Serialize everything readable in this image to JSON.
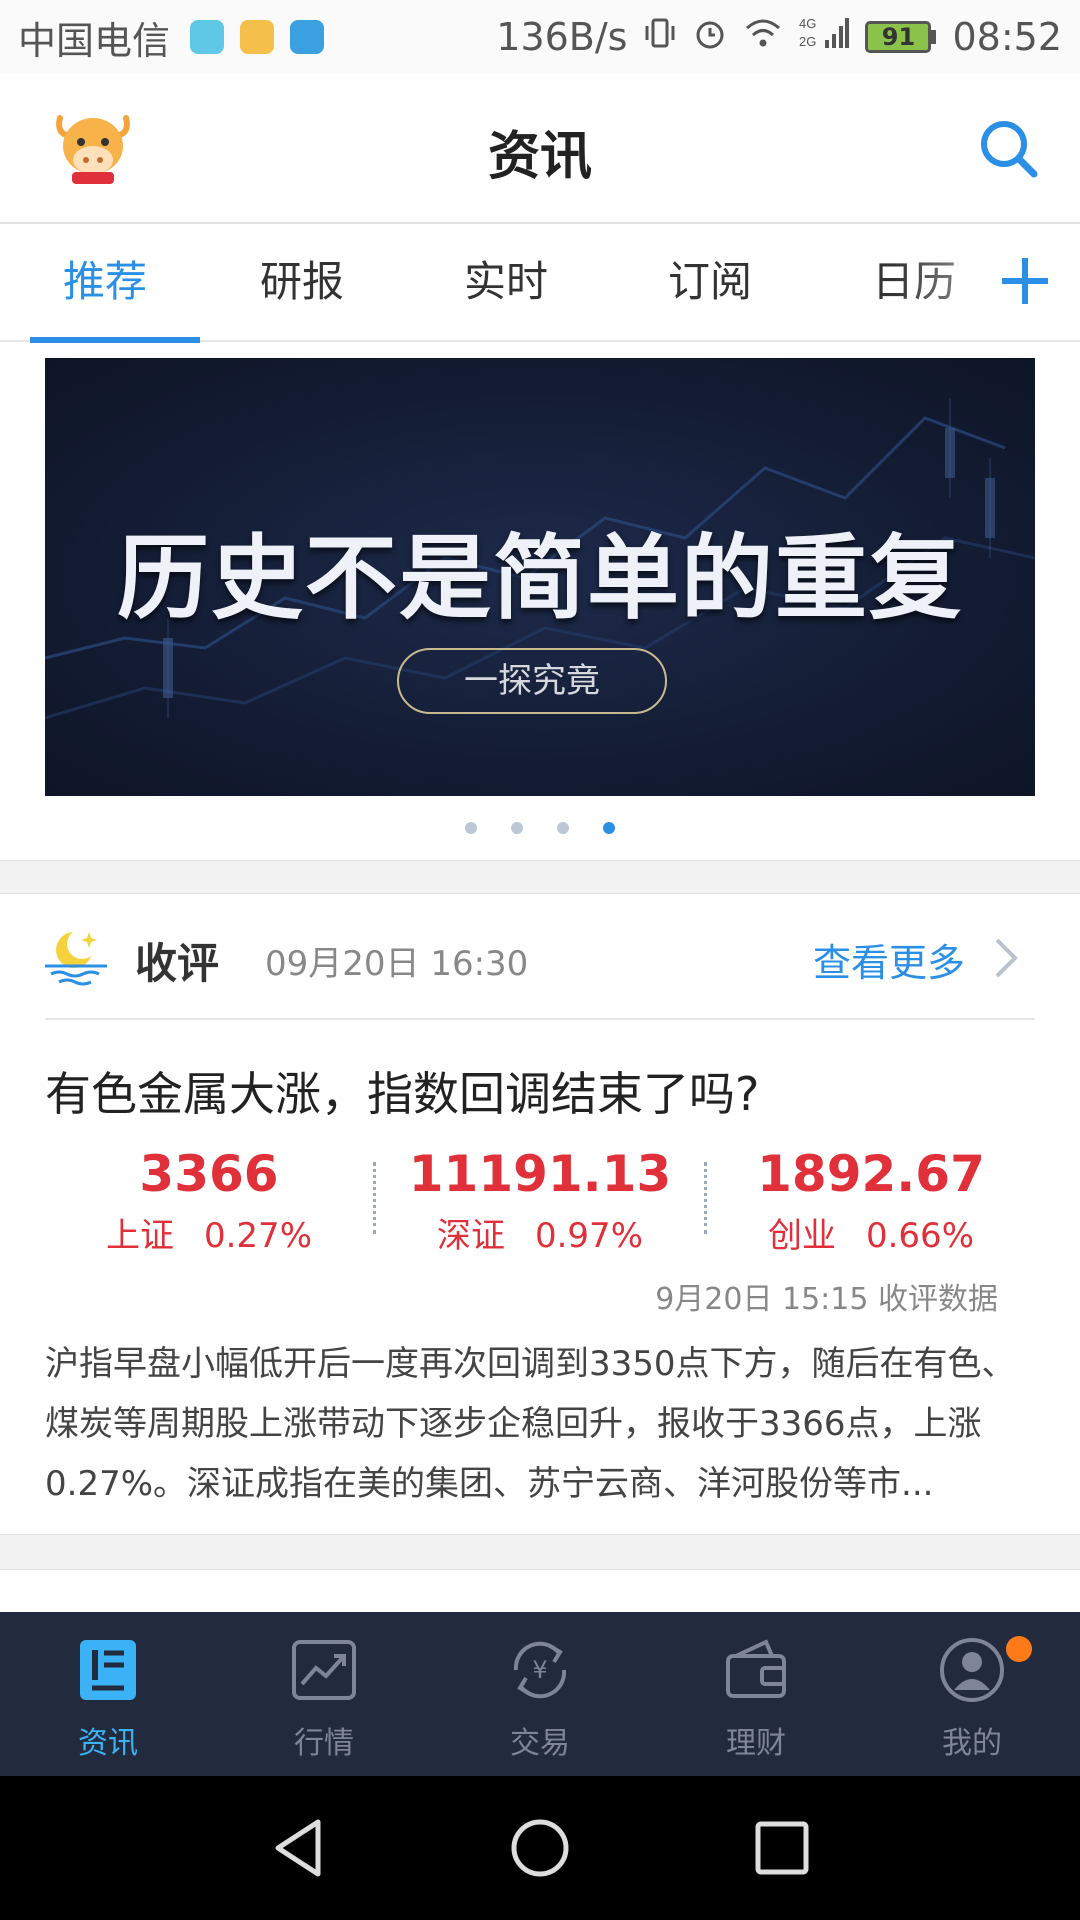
{
  "status_bar": {
    "carrier": "中国电信",
    "speed": "136B/s",
    "network": "4G 2G",
    "battery": "91",
    "time": "08:52"
  },
  "header": {
    "title": "资讯"
  },
  "tabs": [
    {
      "label": "推荐",
      "active": true
    },
    {
      "label": "研报",
      "active": false
    },
    {
      "label": "实时",
      "active": false
    },
    {
      "label": "订阅",
      "active": false
    },
    {
      "label": "日历",
      "active": false
    }
  ],
  "banner": {
    "headline": "历史不是简单的重复",
    "button": "一探究竟",
    "page_count": 4,
    "active_page": 4
  },
  "review": {
    "label": "收评",
    "datetime": "09月20日 16:30",
    "more": "查看更多",
    "headline": "有色金属大涨，指数回调结束了吗?",
    "indices": [
      {
        "value": "3366",
        "name": "上证",
        "change": "0.27%"
      },
      {
        "value": "11191.13",
        "name": "深证",
        "change": "0.97%"
      },
      {
        "value": "1892.67",
        "name": "创业",
        "change": "0.66%"
      }
    ],
    "data_source": "9月20日 15:15 收评数据",
    "summary": "沪指早盘小幅低开后一度再次回调到3350点下方，随后在有色、煤炭等周期股上涨带动下逐步企稳回升，报收于3366点，上涨0.27%。深证成指在美的集团、苏宁云商、洋河股份等市..."
  },
  "bottom_nav": [
    {
      "label": "资讯",
      "icon": "news-icon",
      "active": true
    },
    {
      "label": "行情",
      "icon": "chart-icon",
      "active": false
    },
    {
      "label": "交易",
      "icon": "yuan-exchange-icon",
      "active": false
    },
    {
      "label": "理财",
      "icon": "wallet-icon",
      "active": false
    },
    {
      "label": "我的",
      "icon": "user-icon",
      "active": false
    }
  ],
  "colors": {
    "accent": "#2b90e5",
    "up_red": "#e0303a",
    "nav_bg": "#222a3d",
    "badge": "#ff7b1a"
  }
}
